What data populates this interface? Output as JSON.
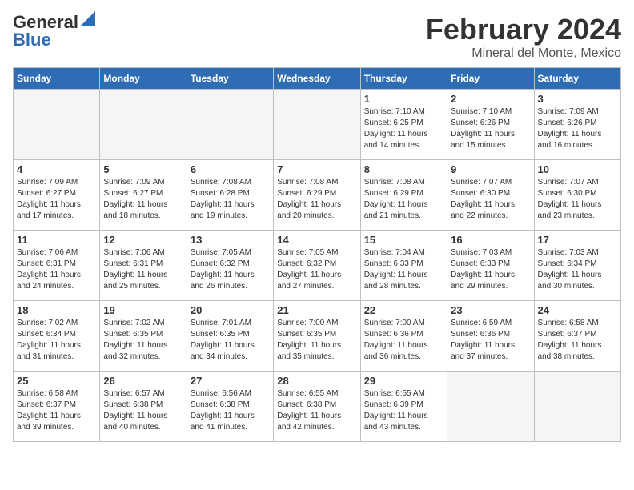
{
  "header": {
    "logo_general": "General",
    "logo_blue": "Blue",
    "title": "February 2024",
    "location": "Mineral del Monte, Mexico"
  },
  "days_of_week": [
    "Sunday",
    "Monday",
    "Tuesday",
    "Wednesday",
    "Thursday",
    "Friday",
    "Saturday"
  ],
  "weeks": [
    [
      {
        "day": "",
        "info": ""
      },
      {
        "day": "",
        "info": ""
      },
      {
        "day": "",
        "info": ""
      },
      {
        "day": "",
        "info": ""
      },
      {
        "day": "1",
        "info": "Sunrise: 7:10 AM\nSunset: 6:25 PM\nDaylight: 11 hours\nand 14 minutes."
      },
      {
        "day": "2",
        "info": "Sunrise: 7:10 AM\nSunset: 6:26 PM\nDaylight: 11 hours\nand 15 minutes."
      },
      {
        "day": "3",
        "info": "Sunrise: 7:09 AM\nSunset: 6:26 PM\nDaylight: 11 hours\nand 16 minutes."
      }
    ],
    [
      {
        "day": "4",
        "info": "Sunrise: 7:09 AM\nSunset: 6:27 PM\nDaylight: 11 hours\nand 17 minutes."
      },
      {
        "day": "5",
        "info": "Sunrise: 7:09 AM\nSunset: 6:27 PM\nDaylight: 11 hours\nand 18 minutes."
      },
      {
        "day": "6",
        "info": "Sunrise: 7:08 AM\nSunset: 6:28 PM\nDaylight: 11 hours\nand 19 minutes."
      },
      {
        "day": "7",
        "info": "Sunrise: 7:08 AM\nSunset: 6:29 PM\nDaylight: 11 hours\nand 20 minutes."
      },
      {
        "day": "8",
        "info": "Sunrise: 7:08 AM\nSunset: 6:29 PM\nDaylight: 11 hours\nand 21 minutes."
      },
      {
        "day": "9",
        "info": "Sunrise: 7:07 AM\nSunset: 6:30 PM\nDaylight: 11 hours\nand 22 minutes."
      },
      {
        "day": "10",
        "info": "Sunrise: 7:07 AM\nSunset: 6:30 PM\nDaylight: 11 hours\nand 23 minutes."
      }
    ],
    [
      {
        "day": "11",
        "info": "Sunrise: 7:06 AM\nSunset: 6:31 PM\nDaylight: 11 hours\nand 24 minutes."
      },
      {
        "day": "12",
        "info": "Sunrise: 7:06 AM\nSunset: 6:31 PM\nDaylight: 11 hours\nand 25 minutes."
      },
      {
        "day": "13",
        "info": "Sunrise: 7:05 AM\nSunset: 6:32 PM\nDaylight: 11 hours\nand 26 minutes."
      },
      {
        "day": "14",
        "info": "Sunrise: 7:05 AM\nSunset: 6:32 PM\nDaylight: 11 hours\nand 27 minutes."
      },
      {
        "day": "15",
        "info": "Sunrise: 7:04 AM\nSunset: 6:33 PM\nDaylight: 11 hours\nand 28 minutes."
      },
      {
        "day": "16",
        "info": "Sunrise: 7:03 AM\nSunset: 6:33 PM\nDaylight: 11 hours\nand 29 minutes."
      },
      {
        "day": "17",
        "info": "Sunrise: 7:03 AM\nSunset: 6:34 PM\nDaylight: 11 hours\nand 30 minutes."
      }
    ],
    [
      {
        "day": "18",
        "info": "Sunrise: 7:02 AM\nSunset: 6:34 PM\nDaylight: 11 hours\nand 31 minutes."
      },
      {
        "day": "19",
        "info": "Sunrise: 7:02 AM\nSunset: 6:35 PM\nDaylight: 11 hours\nand 32 minutes."
      },
      {
        "day": "20",
        "info": "Sunrise: 7:01 AM\nSunset: 6:35 PM\nDaylight: 11 hours\nand 34 minutes."
      },
      {
        "day": "21",
        "info": "Sunrise: 7:00 AM\nSunset: 6:35 PM\nDaylight: 11 hours\nand 35 minutes."
      },
      {
        "day": "22",
        "info": "Sunrise: 7:00 AM\nSunset: 6:36 PM\nDaylight: 11 hours\nand 36 minutes."
      },
      {
        "day": "23",
        "info": "Sunrise: 6:59 AM\nSunset: 6:36 PM\nDaylight: 11 hours\nand 37 minutes."
      },
      {
        "day": "24",
        "info": "Sunrise: 6:58 AM\nSunset: 6:37 PM\nDaylight: 11 hours\nand 38 minutes."
      }
    ],
    [
      {
        "day": "25",
        "info": "Sunrise: 6:58 AM\nSunset: 6:37 PM\nDaylight: 11 hours\nand 39 minutes."
      },
      {
        "day": "26",
        "info": "Sunrise: 6:57 AM\nSunset: 6:38 PM\nDaylight: 11 hours\nand 40 minutes."
      },
      {
        "day": "27",
        "info": "Sunrise: 6:56 AM\nSunset: 6:38 PM\nDaylight: 11 hours\nand 41 minutes."
      },
      {
        "day": "28",
        "info": "Sunrise: 6:55 AM\nSunset: 6:38 PM\nDaylight: 11 hours\nand 42 minutes."
      },
      {
        "day": "29",
        "info": "Sunrise: 6:55 AM\nSunset: 6:39 PM\nDaylight: 11 hours\nand 43 minutes."
      },
      {
        "day": "",
        "info": ""
      },
      {
        "day": "",
        "info": ""
      }
    ]
  ]
}
